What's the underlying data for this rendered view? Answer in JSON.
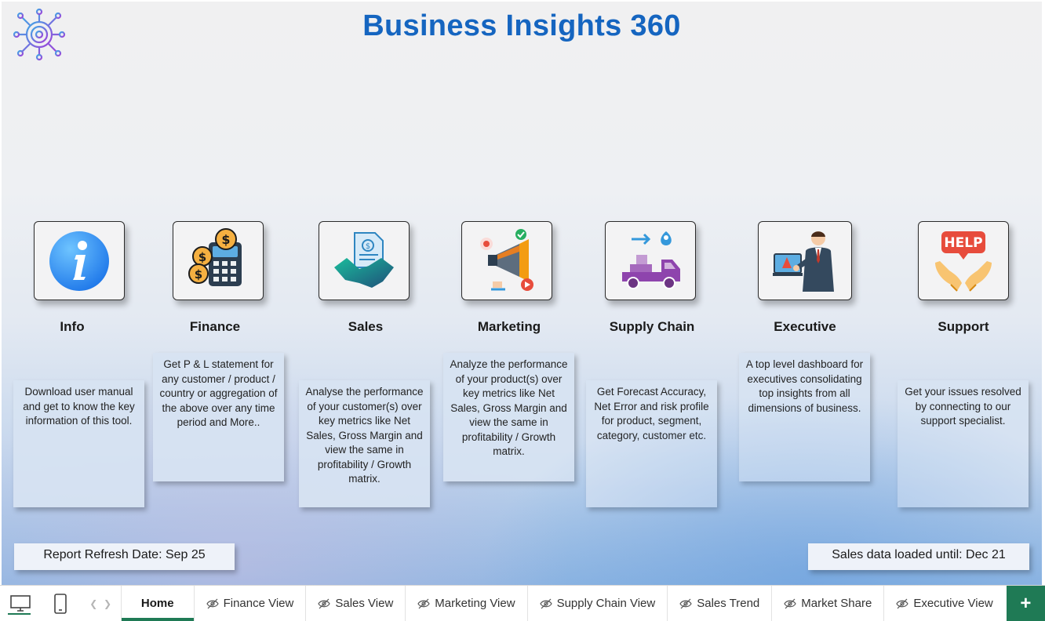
{
  "app": {
    "title": "Business Insights 360"
  },
  "modules": [
    {
      "key": "info",
      "label": "Info",
      "icon": "info-icon",
      "description": "Download user manual and get to know the key information of this tool."
    },
    {
      "key": "finance",
      "label": "Finance",
      "icon": "calculator-coins-icon",
      "description": "Get  P & L statement for any customer / product / country or aggregation of the above over any time period and More.."
    },
    {
      "key": "sales",
      "label": "Sales",
      "icon": "handshake-contract-icon",
      "description": "Analyse the performance of your customer(s) over key metrics like Net Sales, Gross Margin and view the same in profitability / Growth matrix."
    },
    {
      "key": "marketing",
      "label": "Marketing",
      "icon": "megaphone-icon",
      "description": "Analyze the performance of your product(s) over key metrics like Net Sales, Gross Margin and view the same in profitability / Growth matrix."
    },
    {
      "key": "supply-chain",
      "label": "Supply Chain",
      "icon": "delivery-truck-icon",
      "description": "Get Forecast Accuracy, Net Error and risk profile for product, segment, category, customer etc."
    },
    {
      "key": "executive",
      "label": "Executive",
      "icon": "businessman-presentation-icon",
      "description": "A top level dashboard for executives consolidating top insights from all dimensions of business."
    },
    {
      "key": "support",
      "label": "Support",
      "icon": "help-hands-icon",
      "description": "Get your issues resolved by connecting to our support specialist."
    }
  ],
  "footer": {
    "refresh_date": "Report Refresh Date: Sep 25",
    "data_loaded": "Sales data loaded until: Dec 21"
  },
  "tabs": [
    {
      "label": "Home",
      "active": true,
      "hidden_icon": false
    },
    {
      "label": "Finance View",
      "active": false,
      "hidden_icon": true
    },
    {
      "label": "Sales View",
      "active": false,
      "hidden_icon": true
    },
    {
      "label": "Marketing View",
      "active": false,
      "hidden_icon": true
    },
    {
      "label": "Supply Chain View",
      "active": false,
      "hidden_icon": true
    },
    {
      "label": "Sales Trend",
      "active": false,
      "hidden_icon": true
    },
    {
      "label": "Market Share",
      "active": false,
      "hidden_icon": true
    },
    {
      "label": "Executive View",
      "active": false,
      "hidden_icon": true
    }
  ],
  "add_tab_label": "+",
  "colors": {
    "title": "#1565c0",
    "accent": "#1f7a55"
  }
}
